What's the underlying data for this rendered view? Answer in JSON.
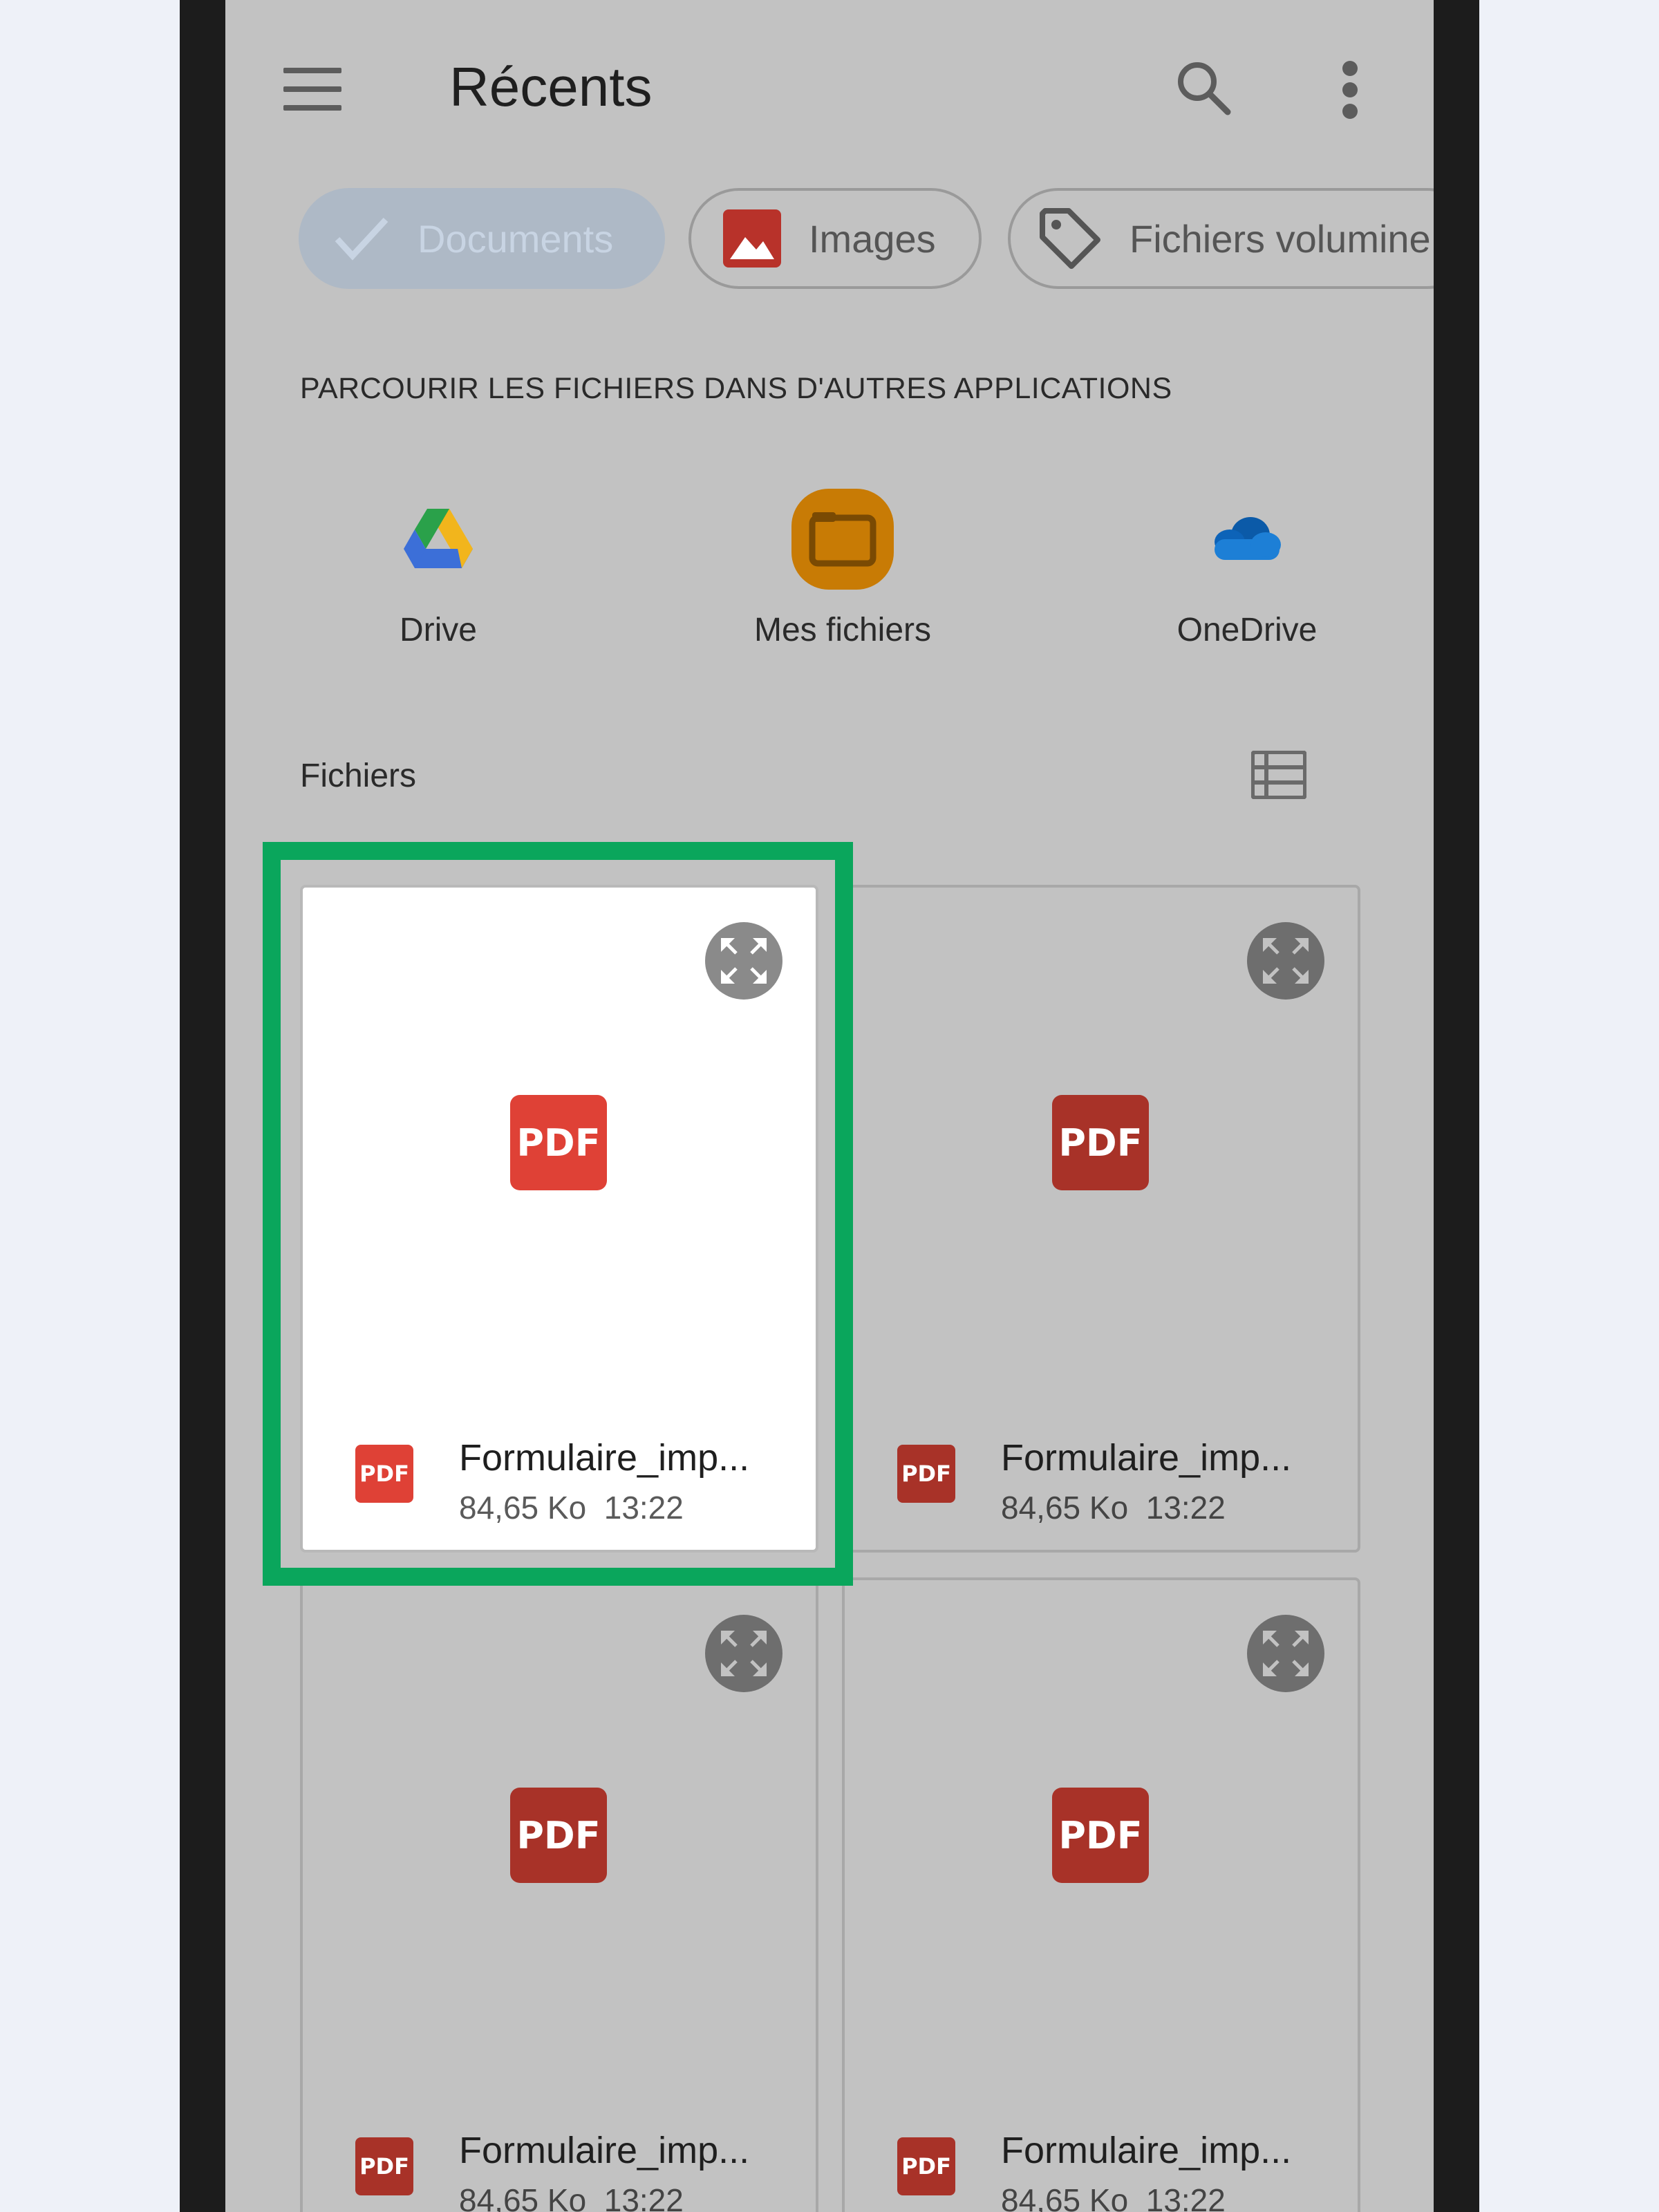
{
  "header": {
    "title": "Récents"
  },
  "chips": [
    {
      "label": "Documents",
      "icon": "check-icon",
      "selected": true
    },
    {
      "label": "Images",
      "icon": "image-icon",
      "selected": false
    },
    {
      "label": "Fichiers volumine",
      "icon": "tag-icon",
      "selected": false
    }
  ],
  "apps_section": {
    "heading": "PARCOURIR LES FICHIERS DANS D'AUTRES APPLICATIONS",
    "apps": [
      {
        "label": "Drive",
        "icon": "google-drive-icon"
      },
      {
        "label": "Mes fichiers",
        "icon": "my-files-icon"
      },
      {
        "label": "OneDrive",
        "icon": "onedrive-icon"
      }
    ]
  },
  "files_section": {
    "heading": "Fichiers",
    "files": [
      {
        "name": "Formulaire_imp...",
        "size": "84,65 Ko",
        "time": "13:22",
        "type_label": "PDF"
      },
      {
        "name": "Formulaire_imp...",
        "size": "84,65 Ko",
        "time": "13:22",
        "type_label": "PDF"
      },
      {
        "name": "Formulaire_imp...",
        "size": "84,65 Ko",
        "time": "13:22",
        "type_label": "PDF"
      },
      {
        "name": "Formulaire_imp...",
        "size": "84,65 Ko",
        "time": "13:22",
        "type_label": "PDF"
      }
    ]
  },
  "colors": {
    "highlight": "#0aa65c",
    "pdf_red": "#df4136",
    "overlay_gray": "#c2c2c2"
  }
}
